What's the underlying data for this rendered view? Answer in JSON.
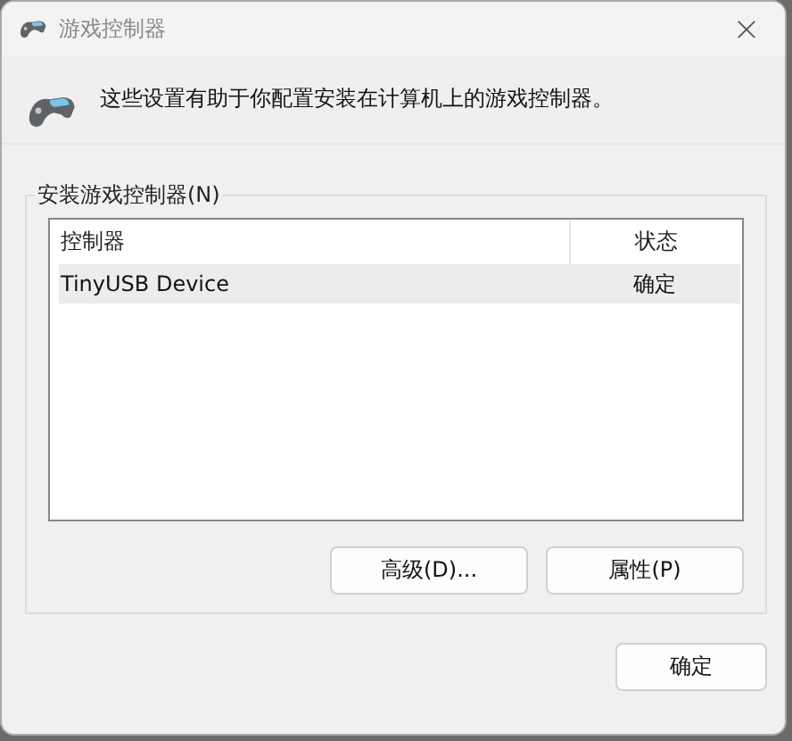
{
  "window": {
    "title": "游戏控制器"
  },
  "description": "这些设置有助于你配置安装在计算机上的游戏控制器。",
  "group": {
    "label": "安装游戏控制器(N)",
    "table": {
      "columns": [
        "控制器",
        "状态"
      ],
      "rows": [
        {
          "cells": [
            "TinyUSB Device",
            "确定"
          ],
          "selected": true
        }
      ]
    },
    "buttons": [
      "高级(D)...",
      "属性(P)"
    ]
  },
  "buttons": [
    "确定"
  ]
}
